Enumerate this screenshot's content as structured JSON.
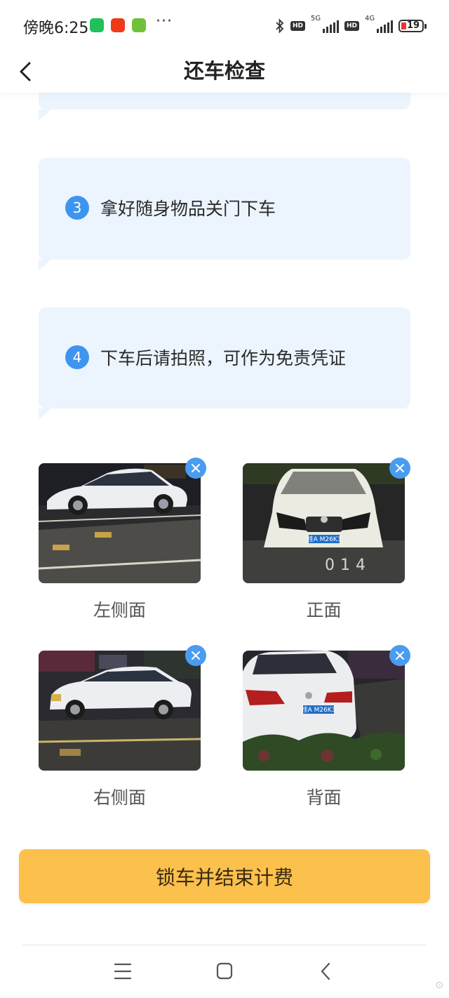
{
  "status_bar": {
    "time": "傍晚6:25",
    "more": "···",
    "net1": "5G",
    "net2": "4G",
    "battery": "19"
  },
  "header": {
    "title": "还车检查"
  },
  "steps": [
    {
      "number": "3",
      "text": "拿好随身物品关门下车"
    },
    {
      "number": "4",
      "text": "下车后请拍照，可作为免责凭证"
    }
  ],
  "photos": [
    {
      "label": "左侧面",
      "plate": ""
    },
    {
      "label": "正面",
      "plate": "桂A M26K3"
    },
    {
      "label": "右侧面",
      "plate": ""
    },
    {
      "label": "背面",
      "plate": "桂A M26K3"
    }
  ],
  "parking_mark": "014",
  "action_button": "锁车并结束计费",
  "colors": {
    "accent_blue": "#3d95ef",
    "card_bg": "#ecf5fe",
    "button_yellow": "#fcc04d"
  },
  "icons": [
    "back-icon",
    "bluetooth-icon",
    "close-icon",
    "menu-icon",
    "home-icon",
    "chevron-left-icon"
  ]
}
